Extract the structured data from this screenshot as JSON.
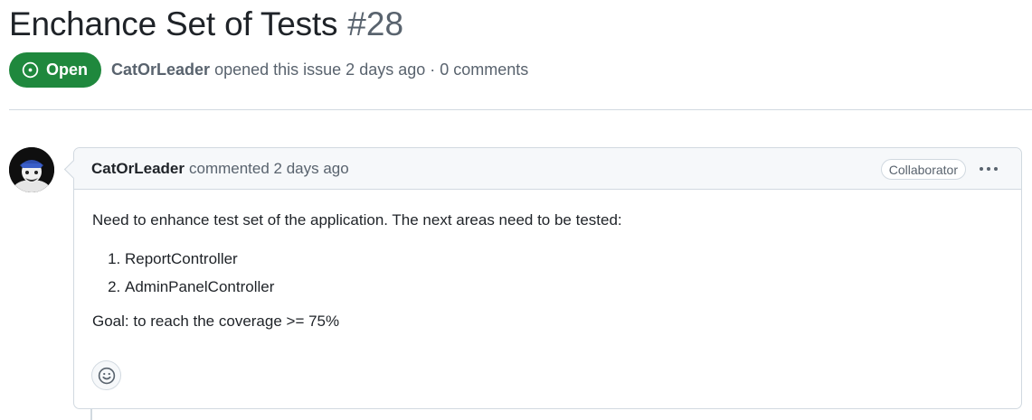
{
  "issue": {
    "title": "Enchance Set of Tests",
    "number": "#28",
    "state": "Open",
    "author": "CatOrLeader",
    "meta_rest": "opened this issue 2 days ago · 0 comments"
  },
  "comment": {
    "author": "CatOrLeader",
    "action": "commented 2 days ago",
    "role_badge": "Collaborator",
    "body_intro": "Need to enhance test set of the application. The next areas need to be tested:",
    "list_items": [
      "ReportController",
      "AdminPanelController"
    ],
    "body_goal": "Goal: to reach the coverage >= 75%"
  },
  "icons": {
    "state": "issue-opened-icon",
    "menu": "kebab-horizontal-icon",
    "reaction": "smiley-icon",
    "avatar": "user-avatar"
  },
  "colors": {
    "open_green": "#1f883d",
    "muted_text": "#59636e",
    "border": "#d1d9e0",
    "header_bg": "#f6f8fa"
  }
}
